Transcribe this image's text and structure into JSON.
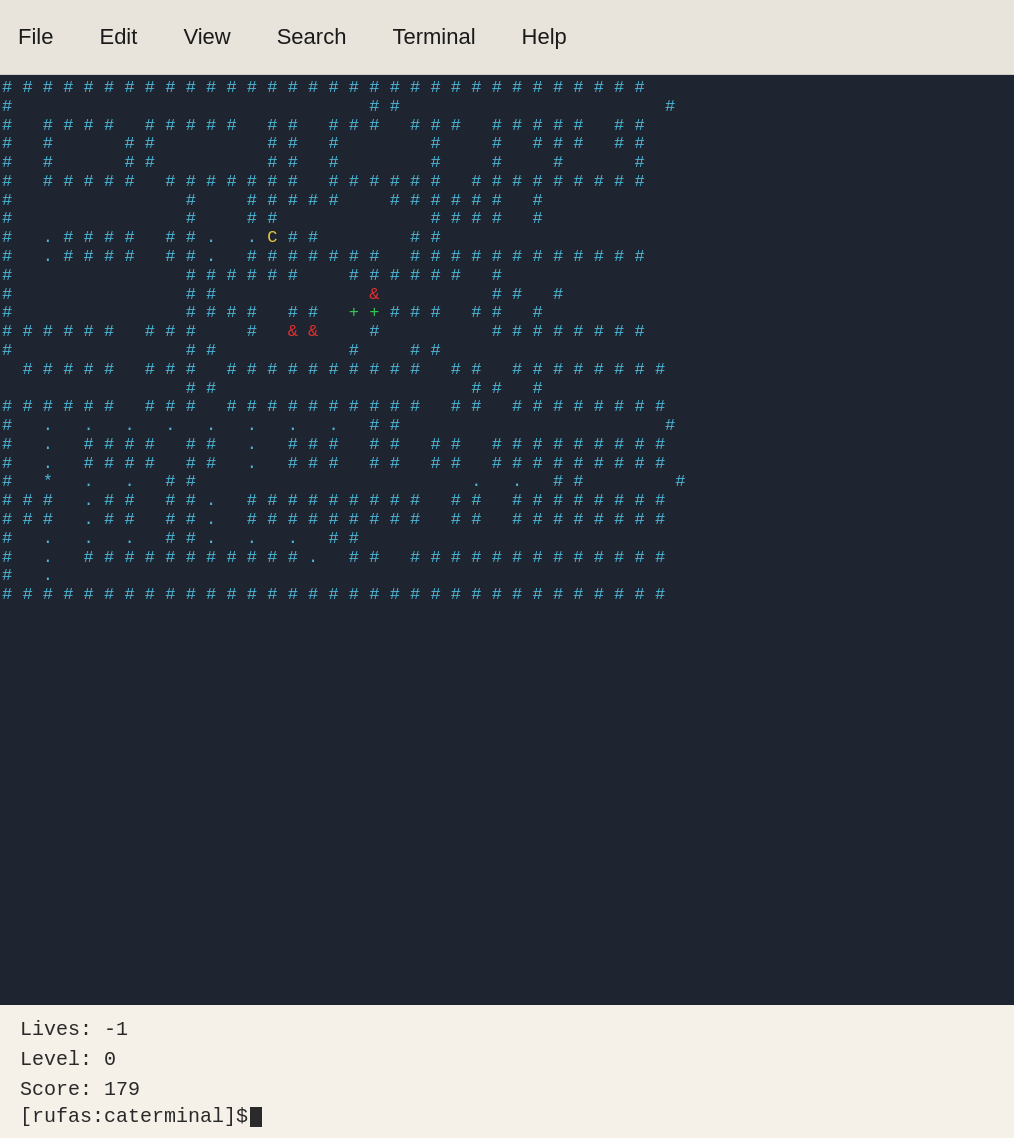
{
  "menubar": {
    "items": [
      "File",
      "Edit",
      "View",
      "Search",
      "Terminal",
      "Help"
    ]
  },
  "statusbar": {
    "lives_label": "Lives:",
    "lives_value": "-1",
    "level_label": "Level:",
    "level_value": "0",
    "score_label": "Score:",
    "score_value": "179",
    "prompt": "[rufas:caterminal]$"
  }
}
